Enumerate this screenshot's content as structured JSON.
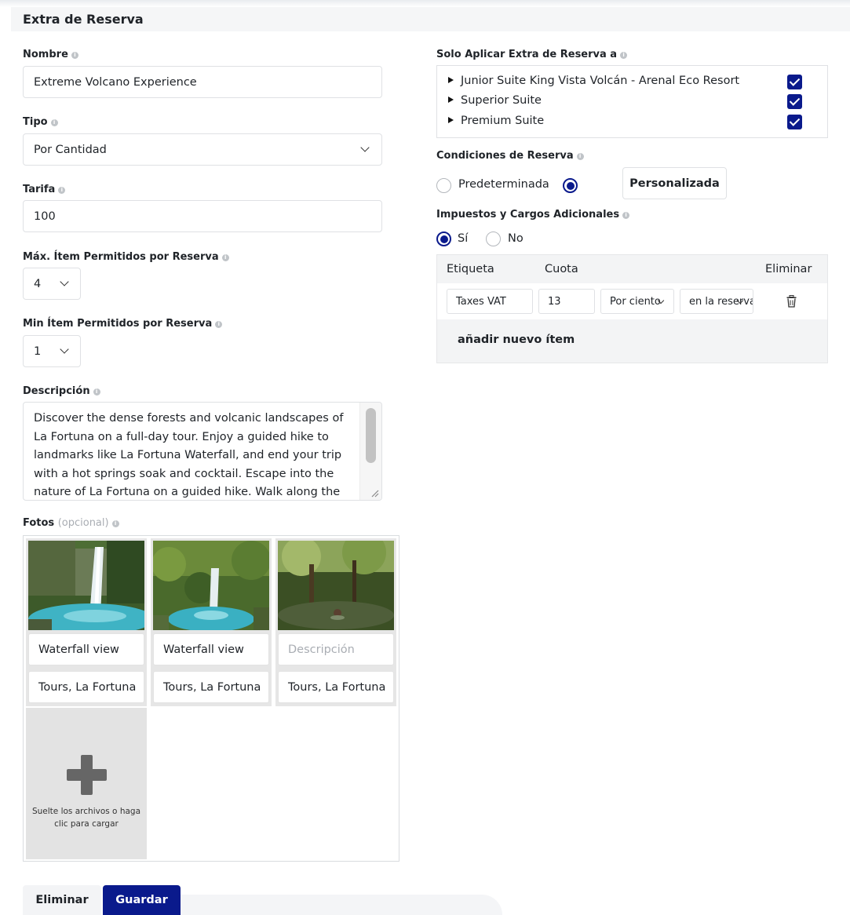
{
  "title": "Extra de Reserva",
  "name": {
    "label": "Nombre",
    "value": "Extreme Volcano Experience"
  },
  "type": {
    "label": "Tipo",
    "value": "Por Cantidad"
  },
  "rate": {
    "label": "Tarifa",
    "value": "100"
  },
  "max_items": {
    "label": "Máx. Ítem Permitidos por Reserva",
    "value": "4"
  },
  "min_items": {
    "label": "Min Ítem Permitidos por Reserva",
    "value": "1"
  },
  "description": {
    "label": "Descripción",
    "value": "Discover the dense forests and volcanic landscapes of La Fortuna on a full-day tour. Enjoy a guided hike to landmarks like La Fortuna Waterfall, and end your trip with a hot springs soak and cocktail. Escape into the nature of La Fortuna on a guided hike. Walk along the"
  },
  "photos": {
    "label": "Fotos",
    "optional": "(opcional)",
    "items": [
      {
        "description": "Waterfall view",
        "description_placeholder": "Descripción",
        "location": "Tours, La Fortuna"
      },
      {
        "description": "Waterfall view",
        "description_placeholder": "Descripción",
        "location": "Tours, La Fortuna"
      },
      {
        "description": "",
        "description_placeholder": "Descripción",
        "location": "Tours, La Fortuna"
      }
    ],
    "upload_text": "Suelte los archivos o haga clic para cargar"
  },
  "buttons": {
    "delete": "Eliminar",
    "save": "Guardar"
  },
  "apply_to": {
    "label": "Solo Aplicar Extra de Reserva a",
    "items": [
      {
        "label": "Junior Suite King Vista Volcán - Arenal Eco Resort",
        "checked": true
      },
      {
        "label": "Superior Suite",
        "checked": true
      },
      {
        "label": "Premium Suite",
        "checked": true
      }
    ]
  },
  "conditions": {
    "label": "Condiciones de Reserva",
    "option_default": "Predeterminada",
    "option_custom": "Personalizada",
    "selected": "custom"
  },
  "taxes": {
    "label": "Impuestos y Cargos Adicionales",
    "option_yes": "Sí",
    "option_no": "No",
    "selected": "yes",
    "headers": {
      "label": "Etiqueta",
      "fee": "Cuota",
      "delete": "Eliminar"
    },
    "rows": [
      {
        "label": "Taxes VAT",
        "fee": "13",
        "fee_type": "Por ciento",
        "applies_to": "en la reserva"
      }
    ],
    "add_item": "añadir nuevo ítem"
  },
  "colors": {
    "primary": "#0a1a8c",
    "border": "#dfe1e4",
    "muted": "#a9adb3"
  },
  "icons": {
    "info": "info-icon",
    "chevron": "chevron-down-icon",
    "trash": "trash-icon",
    "plus": "plus-icon",
    "check": "checkmark-icon"
  }
}
